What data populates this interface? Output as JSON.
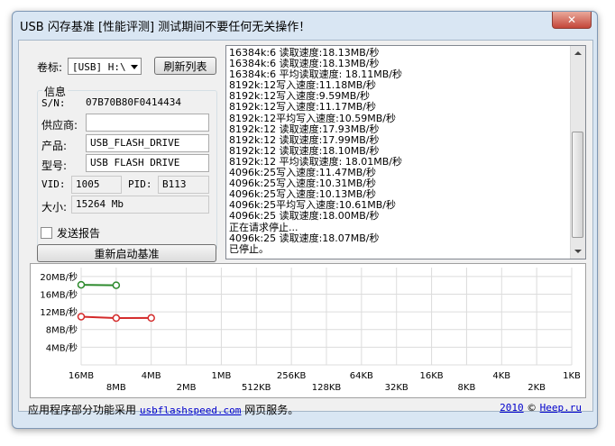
{
  "window": {
    "title": "USB 闪存基准 [性能评测] 测试期间不要任何无关操作！",
    "close_label": "✕"
  },
  "volume": {
    "label": "卷标:",
    "selected": "[USB] H:\\",
    "refresh_label": "刷新列表"
  },
  "info": {
    "group_label": "信息",
    "sn_label": "S/N:",
    "sn_value": "07B70B80F0414434",
    "vendor_label": "供应商:",
    "vendor_value": "",
    "product_label": "产品:",
    "product_value": "USB_FLASH_DRIVE",
    "model_label": "型号:",
    "model_value": "USB FLASH DRIVE",
    "vid_label": "VID:",
    "vid_value": "1005",
    "pid_label": "PID:",
    "pid_value": "B113",
    "size_label": "大小:",
    "size_value": "15264 Mb"
  },
  "actions": {
    "send_report_label": "发送报告",
    "send_report_checked": false,
    "restart_label": "重新启动基准"
  },
  "log": {
    "lines": [
      "16384k:6 读取速度:18.13MB/秒",
      "16384k:6 读取速度:18.13MB/秒",
      "16384k:6 平均读取速度: 18.11MB/秒",
      "8192k:12写入速度:11.18MB/秒",
      "8192k:12写入速度:9.59MB/秒",
      "8192k:12写入速度:11.17MB/秒",
      "8192k:12平均写入速度:10.59MB/秒",
      "8192k:12 读取速度:17.93MB/秒",
      "8192k:12 读取速度:17.99MB/秒",
      "8192k:12 读取速度:18.10MB/秒",
      "8192k:12 平均读取速度: 18.01MB/秒",
      "4096k:25写入速度:11.47MB/秒",
      "4096k:25写入速度:10.31MB/秒",
      "4096k:25写入速度:10.13MB/秒",
      "4096k:25平均写入速度:10.61MB/秒",
      "4096k:25 读取速度:18.00MB/秒",
      "正在请求停止...",
      "4096k:25 读取速度:18.07MB/秒",
      "已停止。"
    ]
  },
  "chart_data": {
    "type": "line",
    "y_ticks": [
      "20MB/秒",
      "16MB/秒",
      "12MB/秒",
      "8MB/秒",
      "4MB/秒"
    ],
    "y_tick_values": [
      20,
      16,
      12,
      8,
      4
    ],
    "x_ticks_upper": [
      "16MB",
      "4MB",
      "1MB",
      "256KB",
      "64KB",
      "16KB",
      "4KB",
      "1KB"
    ],
    "x_ticks_lower": [
      "8MB",
      "2MB",
      "512KB",
      "128KB",
      "32KB",
      "8KB",
      "2KB"
    ],
    "x_categories": [
      "16MB",
      "8MB",
      "4MB",
      "2MB",
      "1MB",
      "512KB",
      "256KB",
      "128KB",
      "64KB",
      "32KB",
      "16KB",
      "8KB",
      "4KB",
      "2KB",
      "1KB"
    ],
    "ylim": [
      0,
      22
    ],
    "grid": true,
    "series": [
      {
        "role": "read",
        "color": "#2e8b2e",
        "values": [
          18.11,
          18.01
        ]
      },
      {
        "role": "write",
        "color": "#d42a2a",
        "values": [
          10.9,
          10.59,
          10.61
        ]
      }
    ]
  },
  "footer": {
    "prefix": "应用程序部分功能采用",
    "link": "usbflashspeed.com",
    "suffix": "网页服务。",
    "copyright_year": "2010",
    "copyright_symbol": "©",
    "copyright_link": "Heep.ru"
  }
}
